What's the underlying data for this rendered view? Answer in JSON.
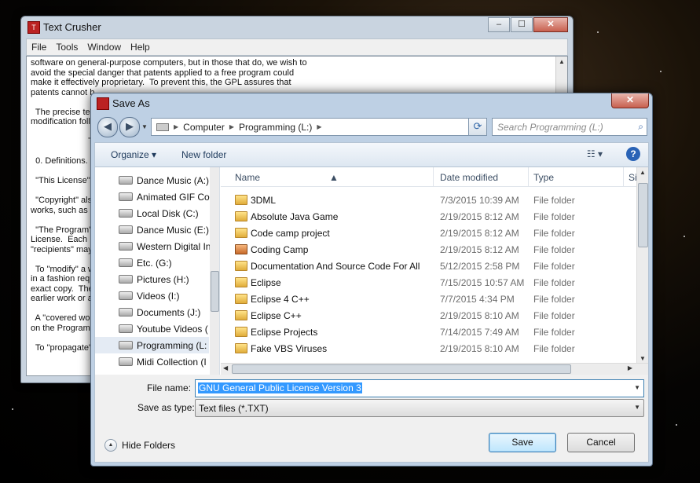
{
  "text_crusher": {
    "title": "Text Crusher",
    "menu": [
      "File",
      "Tools",
      "Window",
      "Help"
    ],
    "lines": [
      "software on general-purpose computers, but in those that do, we wish to",
      "avoid the special danger that patents applied to a free program could",
      "make it effectively proprietary.  To prevent this, the GPL assures that",
      "patents cannot b",
      "",
      "  The precise ter",
      "modification follo",
      "",
      "                        T",
      "",
      "  0. Definitions.",
      "",
      "  \"This License\"",
      "",
      "  \"Copyright\" als",
      "works, such as s",
      "",
      "  \"The Program\"",
      "License.  Each l",
      "\"recipients\" may",
      "",
      "  To \"modify\" a w",
      "in a fashion requ",
      "exact copy.  The",
      "earlier work or a",
      "",
      "  A \"covered wo",
      "on the Program.",
      "",
      "  To \"propagate\""
    ]
  },
  "dialog": {
    "title": "Save As",
    "address": {
      "parts": [
        "Computer",
        "Programming (L:)"
      ]
    },
    "search_placeholder": "Search Programming (L:)",
    "toolbar": {
      "organize": "Organize ▾",
      "new_folder": "New folder"
    },
    "nav_items": [
      "Dance Music (A:)",
      "Animated GIF Co",
      "Local Disk (C:)",
      "Dance Music (E:)",
      "Western Digital In",
      "Etc. (G:)",
      "Pictures (H:)",
      "Videos (I:)",
      "Documents (J:)",
      "Youtube Videos (",
      "Programming (L:",
      "Midi Collection (I"
    ],
    "columns": {
      "name": "Name",
      "date": "Date modified",
      "type": "Type",
      "size": "Si"
    },
    "files": [
      {
        "name": "3DML",
        "date": "7/3/2015 10:39 AM",
        "type": "File folder"
      },
      {
        "name": "Absolute Java Game",
        "date": "2/19/2015 8:12 AM",
        "type": "File folder"
      },
      {
        "name": "Code camp project",
        "date": "2/19/2015 8:12 AM",
        "type": "File folder"
      },
      {
        "name": "Coding Camp",
        "date": "2/19/2015 8:12 AM",
        "type": "File folder"
      },
      {
        "name": "Documentation And Source Code For All",
        "date": "5/12/2015 2:58 PM",
        "type": "File folder"
      },
      {
        "name": "Eclipse",
        "date": "7/15/2015 10:57 AM",
        "type": "File folder"
      },
      {
        "name": "Eclipse 4 C++",
        "date": "7/7/2015 4:34 PM",
        "type": "File folder"
      },
      {
        "name": "Eclipse C++",
        "date": "2/19/2015 8:10 AM",
        "type": "File folder"
      },
      {
        "name": "Eclipse Projects",
        "date": "7/14/2015 7:49 AM",
        "type": "File folder"
      },
      {
        "name": "Fake VBS Viruses",
        "date": "2/19/2015 8:10 AM",
        "type": "File folder"
      }
    ],
    "file_name_label": "File name:",
    "file_name_value": "GNU General Public License Version 3",
    "save_type_label": "Save as type:",
    "save_type_value": "Text files (*.TXT)",
    "hide_folders": "Hide Folders",
    "save": "Save",
    "cancel": "Cancel"
  }
}
